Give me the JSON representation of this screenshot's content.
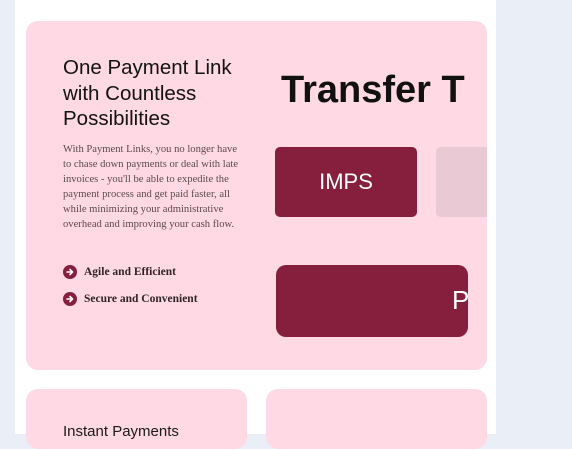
{
  "hero": {
    "title": "One Payment Link with Countless Possibilities",
    "description": "With Payment Links, you no longer have to chase down payments or deal with late invoices - you'll be able to expedite the payment process and get paid faster, all while minimizing your administrative overhead and improving your cash flow.",
    "features": [
      {
        "label": "Agile and Efficient",
        "icon": "arrow-circle-right-icon"
      },
      {
        "label": "Secure and Convenient",
        "icon": "arrow-circle-right-icon"
      }
    ],
    "visual": {
      "transfer_heading": "Transfer T",
      "imps_label": "IMPS",
      "pay_label": "P"
    }
  },
  "cards": [
    {
      "title": "Instant Payments"
    },
    {
      "title": ""
    }
  ],
  "colors": {
    "page_bg": "#eaeef7",
    "card_bg": "#ffd9e3",
    "accent": "#861e3e",
    "ghost": "#e8c9d4"
  }
}
